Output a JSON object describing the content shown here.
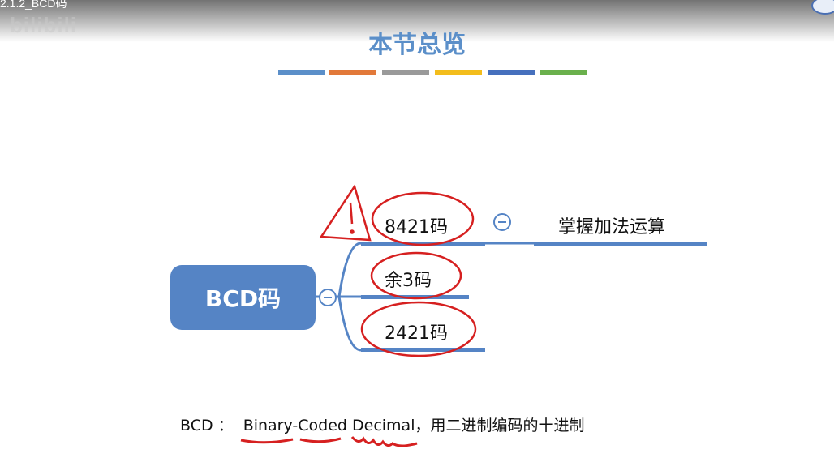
{
  "video": {
    "title": "2.1.2_BCD码",
    "watermark": "bilibili"
  },
  "slide": {
    "title": "本节总览",
    "color_bars": [
      "#5b8fc9",
      "#e2793a",
      "#9a9a9a",
      "#f3bd1c",
      "#4670bd",
      "#6ab04c"
    ]
  },
  "mindmap": {
    "root": "BCD码",
    "branches": [
      {
        "label": "8421码",
        "child": "掌握加法运算"
      },
      {
        "label": "余3码"
      },
      {
        "label": "2421码"
      }
    ],
    "collapse_icon": "minus-icon"
  },
  "footer": {
    "prefix": "BCD ：",
    "term": "Binary-Coded Decimal",
    "suffix": "，用二进制编码的十进制"
  },
  "colors": {
    "node_fill": "#5584c5",
    "line": "#5584c5",
    "annotation_red": "#d62020"
  }
}
